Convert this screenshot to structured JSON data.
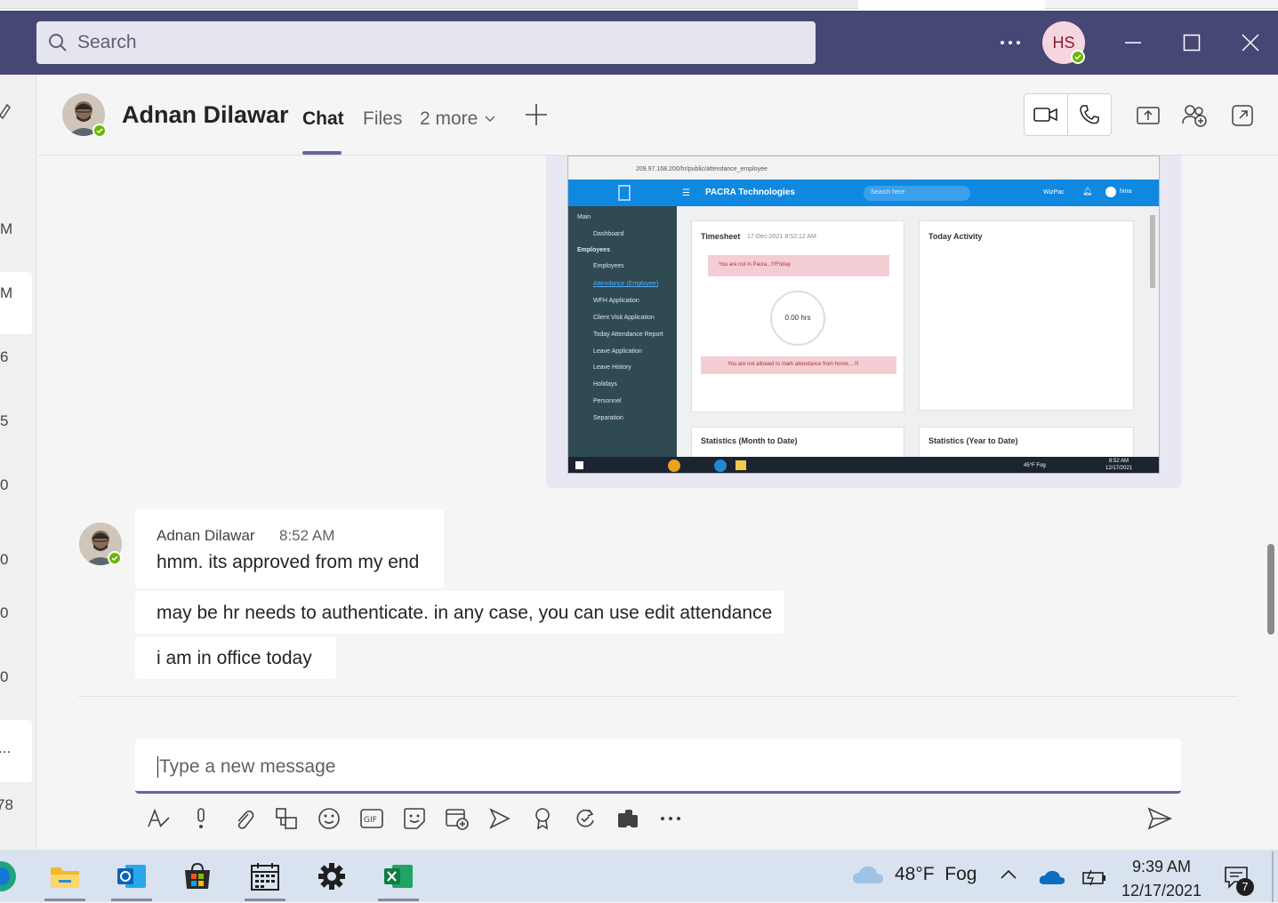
{
  "app": {
    "search_placeholder": "Search",
    "user_initials": "HS"
  },
  "left_rail": {
    "items": [
      "M",
      "M",
      "6",
      "5",
      "0",
      "0",
      "0",
      "0",
      "...",
      "78"
    ]
  },
  "chat_header": {
    "name": "Adnan Dilawar",
    "tabs": [
      {
        "label": "Chat",
        "active": true
      },
      {
        "label": "Files",
        "active": false
      },
      {
        "label": "2 more",
        "active": false
      }
    ]
  },
  "screenshot": {
    "address": "209.97.168.200/hr/public/attendance_employee",
    "brand": "PACRA Technologies",
    "search": "Search here",
    "top_right": "WizPac",
    "user": "hina",
    "side_section1": "Main",
    "side_items": [
      "Dashboard"
    ],
    "side_section2": "Employees",
    "employees_label": "Employees",
    "employee_subitems": [
      "Attendance (Employee)",
      "WFH Application",
      "Client Visit Application",
      "Today Attendance Report",
      "Leave Application",
      "Leave History",
      "Holidays",
      "Personnel",
      "Separation"
    ],
    "timesheet_title": "Timesheet",
    "timesheet_date": "17-Dec-2021 8:52:12 AM",
    "alert1": "You are not in Pacra...!!!Friday",
    "hours": "0.00 hrs",
    "alert2": "You are not allowed to mark attendance from home....!!!",
    "activity_title": "Today Activity",
    "stats_month": "Statistics (Month to Date)",
    "stats_year": "Statistics (Year to Date)",
    "tray_weather": "45°F Fog",
    "tray_time": "8:52 AM",
    "tray_date": "12/17/2021"
  },
  "messages": [
    {
      "author": "Adnan Dilawar",
      "time": "8:52 AM",
      "text": "hmm. its approved from my end"
    },
    {
      "text": "may be hr needs to authenticate. in any case, you can use edit attendance"
    },
    {
      "text": "i am in office today"
    }
  ],
  "compose": {
    "placeholder": "Type a new message"
  },
  "taskbar": {
    "weather": "48°F  Fog",
    "time": "9:39 AM",
    "date": "12/17/2021",
    "notifications": "7"
  },
  "colors": {
    "title_bar": "#464775",
    "accent": "#6264a7",
    "presence": "#6bb700"
  }
}
